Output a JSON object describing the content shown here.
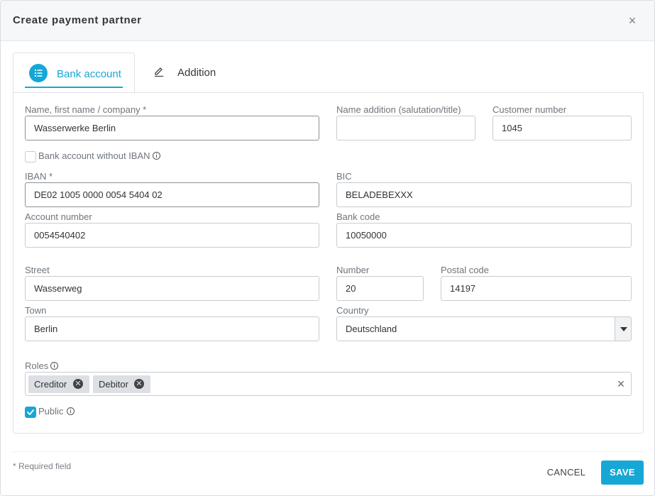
{
  "dialog": {
    "title": "Create payment partner",
    "close_glyph": "×"
  },
  "tabs": [
    {
      "label": "Bank account",
      "icon": "list-icon",
      "active": true
    },
    {
      "label": "Addition",
      "icon": "pencil-icon",
      "active": false
    }
  ],
  "form": {
    "name": {
      "label": "Name, first name / company *",
      "value": "Wasserwerke Berlin"
    },
    "name_addition": {
      "label": "Name addition (salutation/title)",
      "value": ""
    },
    "customer_number": {
      "label": "Customer number",
      "value": "1045"
    },
    "no_iban": {
      "label": "Bank account without IBAN",
      "checked": false
    },
    "iban": {
      "label": "IBAN *",
      "value": "DE02 1005 0000 0054 5404 02"
    },
    "bic": {
      "label": "BIC",
      "value": "BELADEBEXXX"
    },
    "account_number": {
      "label": "Account number",
      "value": "0054540402"
    },
    "bank_code": {
      "label": "Bank code",
      "value": "10050000"
    },
    "street": {
      "label": "Street",
      "value": "Wasserweg"
    },
    "number": {
      "label": "Number",
      "value": "20"
    },
    "postal_code": {
      "label": "Postal code",
      "value": "14197"
    },
    "town": {
      "label": "Town",
      "value": "Berlin"
    },
    "country": {
      "label": "Country",
      "value": "Deutschland"
    },
    "roles": {
      "label": "Roles",
      "chips": [
        "Creditor",
        "Debitor"
      ],
      "clear_glyph": "×"
    },
    "public": {
      "label": "Public",
      "checked": true
    }
  },
  "footer": {
    "required_note": "* Required field",
    "cancel_label": "CANCEL",
    "save_label": "SAVE"
  },
  "colors": {
    "accent": "#17a7d6",
    "header_bg": "#f6f7f9",
    "border": "#c8ccd1"
  }
}
